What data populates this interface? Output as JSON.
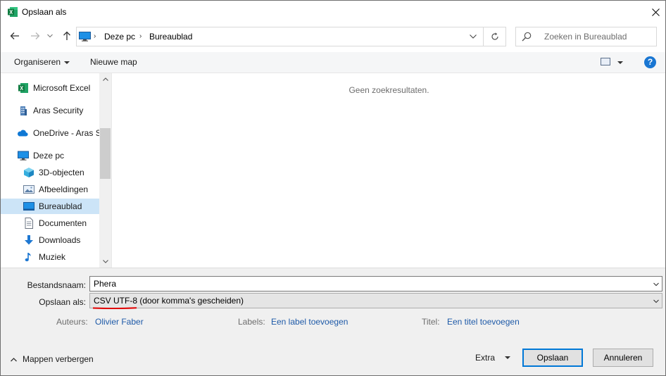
{
  "window": {
    "title": "Opslaan als",
    "app_icon": "excel-icon",
    "close_icon": "close-icon"
  },
  "address": {
    "root_icon": "computer-icon",
    "crumbs": [
      "Deze pc",
      "Bureaublad"
    ],
    "search_placeholder": "Zoeken in Bureaublad"
  },
  "toolbar": {
    "organize_label": "Organiseren",
    "new_folder_label": "Nieuwe map",
    "help_label": "?"
  },
  "navigation": {
    "items": [
      {
        "label": "Microsoft Excel",
        "icon": "excel-icon"
      },
      {
        "label": "Aras Security",
        "icon": "building-icon"
      },
      {
        "label": "OneDrive - Aras Se",
        "icon": "cloud-icon"
      },
      {
        "label": "Deze pc",
        "icon": "computer-icon"
      },
      {
        "label": "3D-objecten",
        "icon": "cube-icon"
      },
      {
        "label": "Afbeeldingen",
        "icon": "pictures-icon"
      },
      {
        "label": "Bureaublad",
        "icon": "desktop-icon",
        "selected": true
      },
      {
        "label": "Documenten",
        "icon": "document-icon"
      },
      {
        "label": "Downloads",
        "icon": "download-icon"
      },
      {
        "label": "Muziek",
        "icon": "music-icon"
      }
    ]
  },
  "content": {
    "empty_message": "Geen zoekresultaten."
  },
  "form": {
    "filename_label": "Bestandsnaam:",
    "filename_value": "Phera",
    "savetype_label": "Opslaan als:",
    "savetype_value": "CSV UTF-8 (door komma's gescheiden)",
    "authors_label": "Auteurs:",
    "authors_value": "Olivier Faber",
    "labels_label": "Labels:",
    "labels_value": "Een label toevoegen",
    "title_label": "Titel:",
    "title_value": "Een titel toevoegen",
    "annotation_color": "#e00000"
  },
  "footer": {
    "hide_folders_label": "Mappen verbergen",
    "extra_label": "Extra",
    "save_label": "Opslaan",
    "cancel_label": "Annuleren"
  }
}
